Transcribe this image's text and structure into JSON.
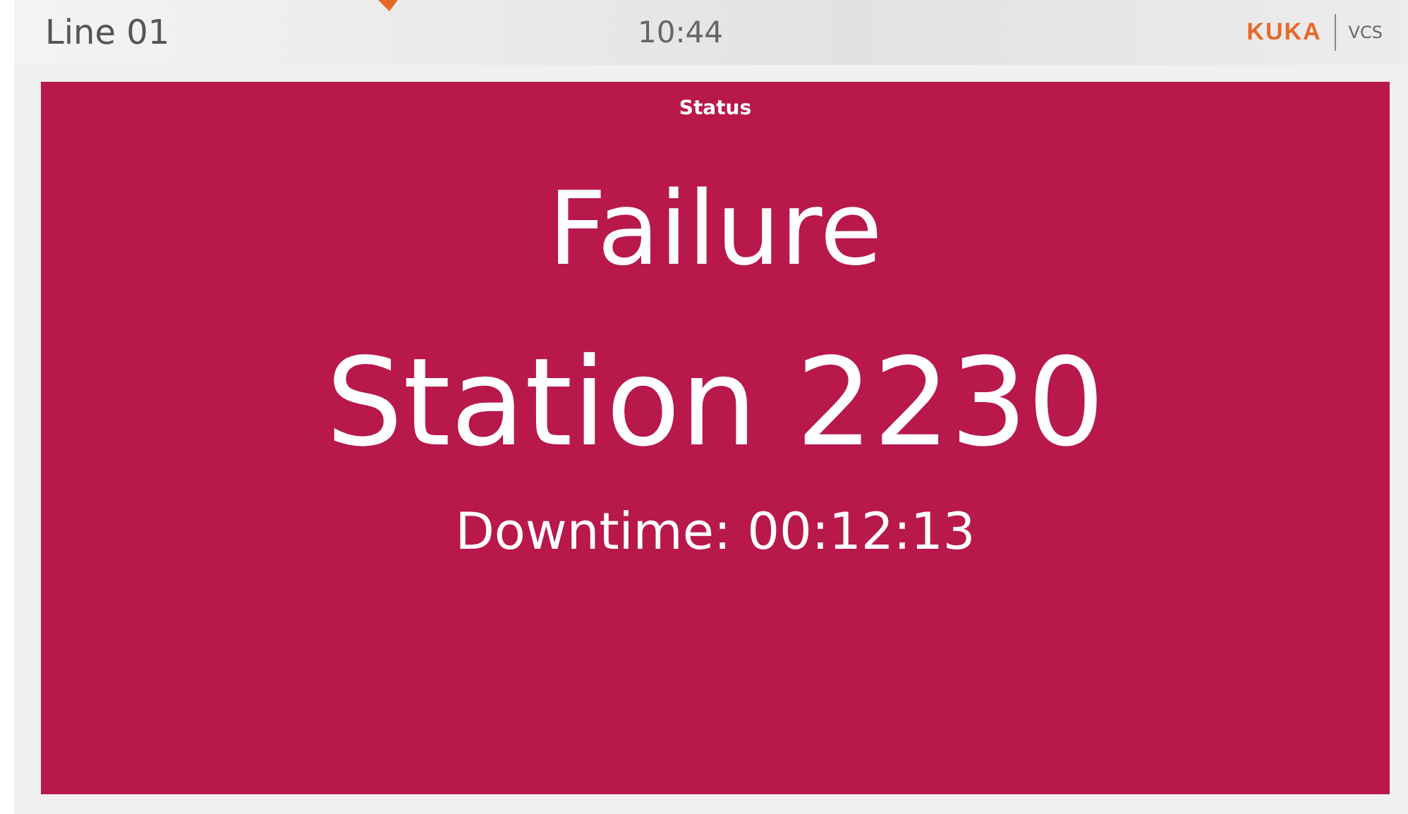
{
  "header": {
    "line": "Line 01",
    "time": "10:44",
    "logo": "KUKA",
    "product": "VCS"
  },
  "status": {
    "kind": "failure",
    "label": "Status",
    "title": "Failure",
    "station": "Station 2230",
    "downtime": "Downtime: 00:12:13"
  }
}
